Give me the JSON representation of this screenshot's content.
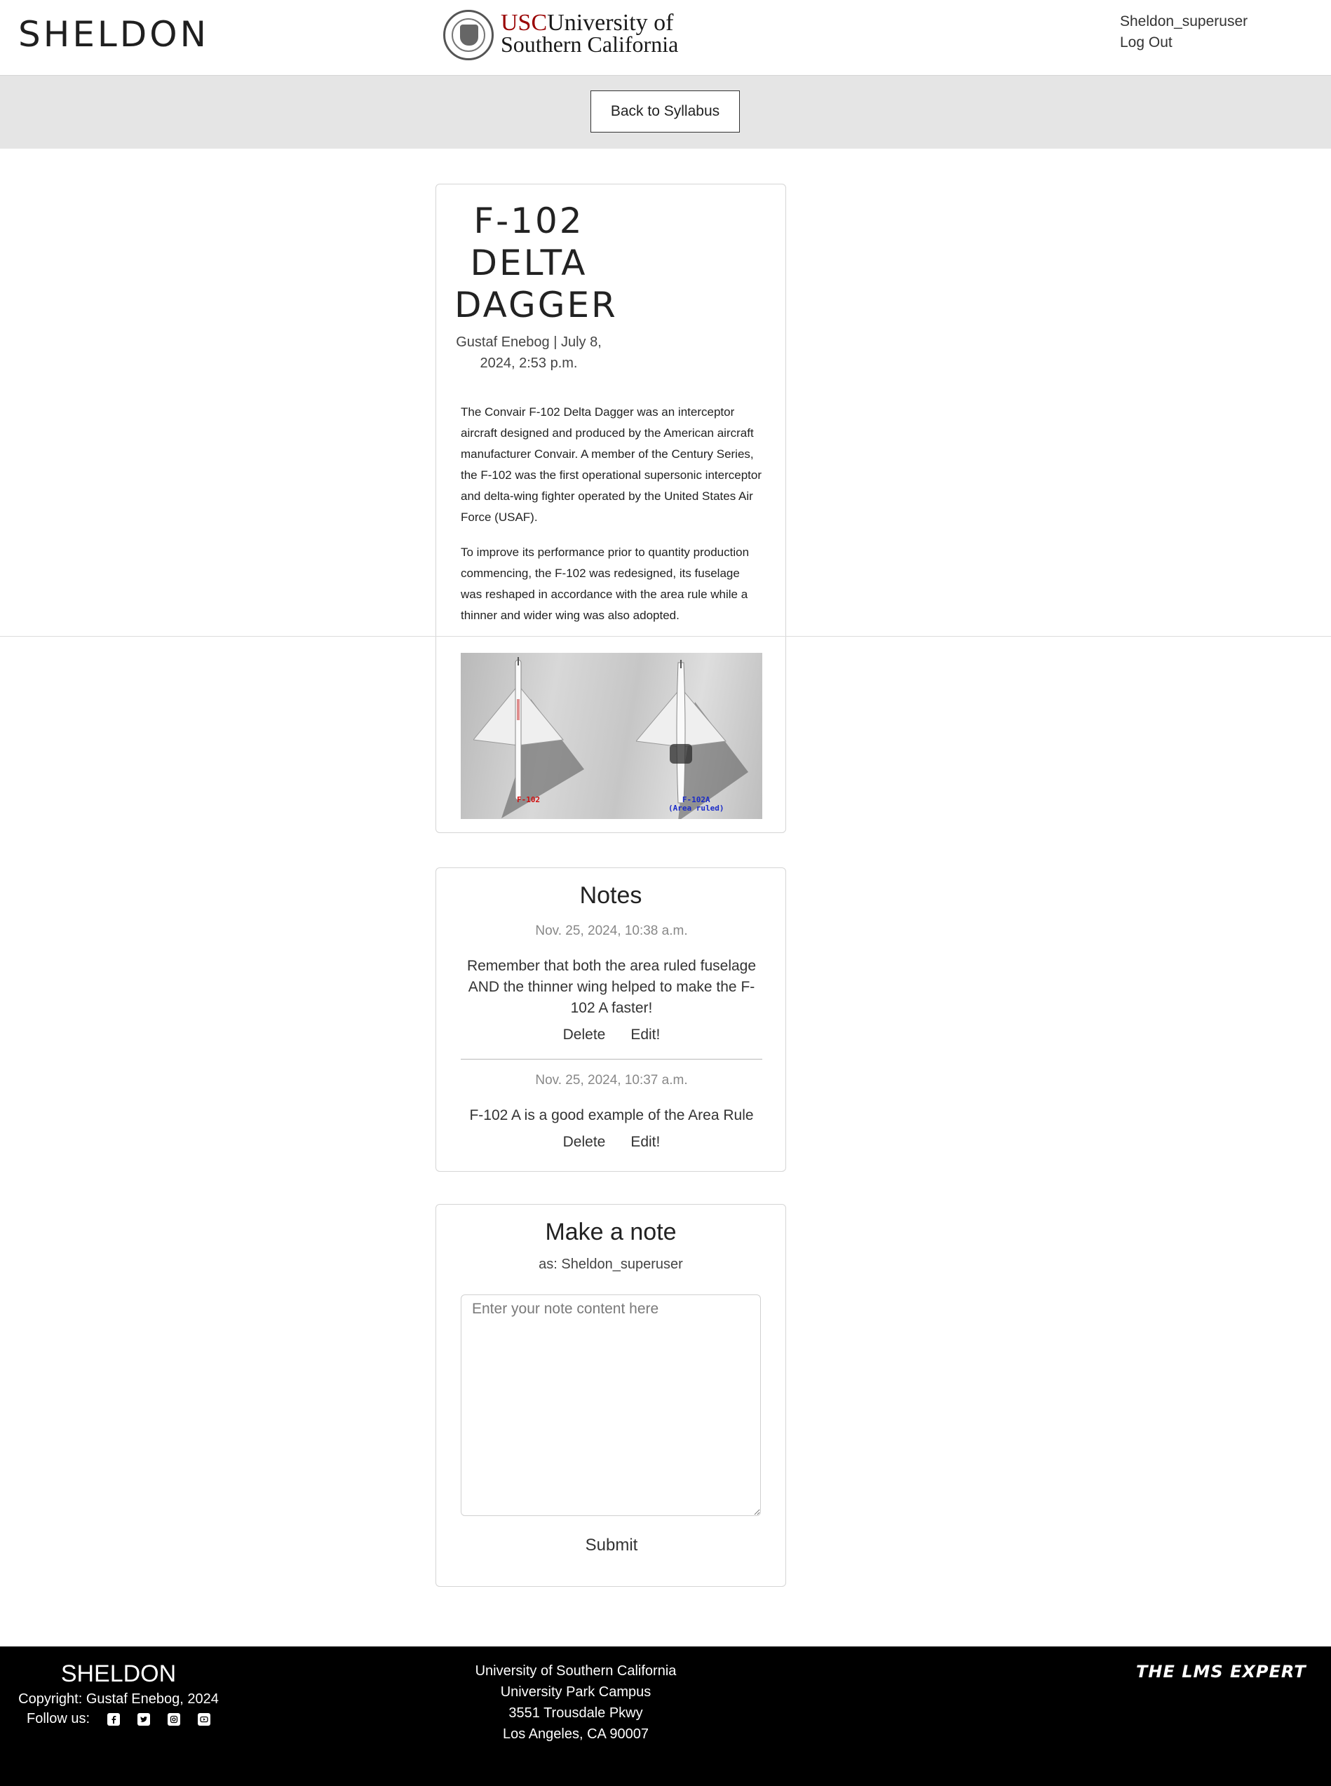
{
  "header": {
    "brand": "SHELDON",
    "university_logo": {
      "abbr": "USC",
      "name_line1": "University of",
      "name_line2": "Southern California"
    },
    "user": "Sheldon_superuser",
    "logout": "Log Out"
  },
  "subnav": {
    "back_button": "Back to Syllabus"
  },
  "article": {
    "title_lines": [
      "F-102",
      "DELTA",
      "DAGGER"
    ],
    "meta_line1": "Gustaf Enebog | July 8,",
    "meta_line2": "2024, 2:53 p.m.",
    "paragraphs": [
      "The Convair F-102 Delta Dagger was an interceptor aircraft designed and produced by the American aircraft manufacturer Convair. A member of the Century Series, the F-102 was the first operational supersonic interceptor and delta-wing fighter operated by the United States Air Force (USAF).",
      "To improve its performance prior to quantity production commencing, the F-102 was redesigned, its fuselage was reshaped in accordance with the area rule while a thinner and wider wing was also adopted."
    ],
    "image": {
      "left_label": "F-102",
      "right_label_1": "F-102A",
      "right_label_2": "(Area ruled)"
    }
  },
  "notes": {
    "title": "Notes",
    "items": [
      {
        "date": "Nov. 25, 2024, 10:38 a.m.",
        "content": "Remember that both the area ruled fuselage AND the thinner wing helped to make the F-102 A faster!",
        "delete": "Delete",
        "edit": "Edit!"
      },
      {
        "date": "Nov. 25, 2024, 10:37 a.m.",
        "content": "F-102 A is a good example of the Area Rule",
        "delete": "Delete",
        "edit": "Edit!"
      }
    ]
  },
  "make_note": {
    "title": "Make a note",
    "as_line": "as: Sheldon_superuser",
    "placeholder": "Enter your note content here",
    "value": "",
    "submit": "Submit"
  },
  "footer": {
    "brand": "SHELDON",
    "copyright": "Copyright: Gustaf Enebog, 2024",
    "follow": "Follow us:",
    "social_icons": [
      "facebook-icon",
      "twitter-icon",
      "instagram-icon",
      "youtube-icon"
    ],
    "address": [
      "University of Southern California",
      "University Park Campus",
      "3551 Trousdale Pkwy",
      "Los Angeles, CA 90007"
    ],
    "partner_logo": "THE LMS EXPERT"
  },
  "colors": {
    "usc_red": "#990000",
    "footer_bg": "#000000",
    "subnav_bg": "#e5e5e5"
  }
}
